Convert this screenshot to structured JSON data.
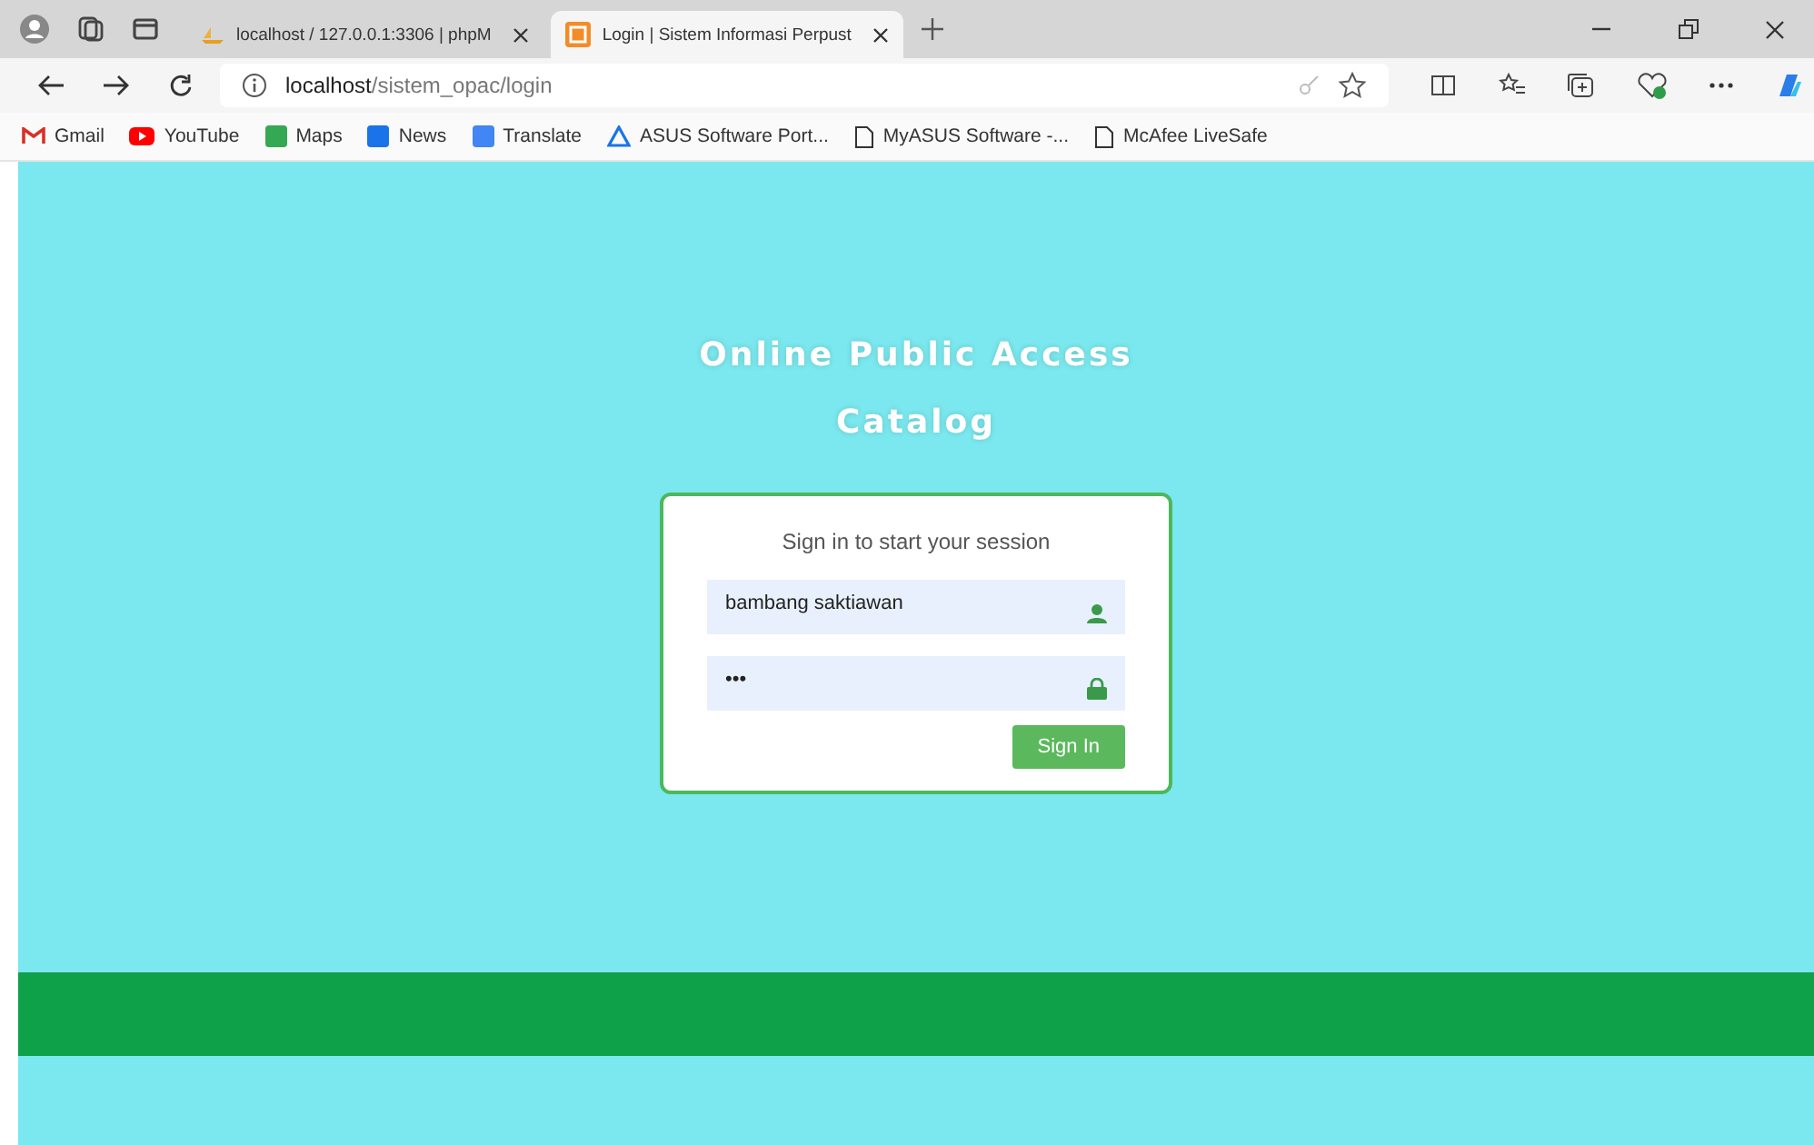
{
  "browser": {
    "tabs": [
      {
        "title": "localhost / 127.0.0.1:3306 | phpM",
        "kind": "db",
        "selected": false
      },
      {
        "title": "Login | Sistem Informasi Perpust",
        "kind": "app",
        "selected": true
      }
    ],
    "url_host": "localhost",
    "url_path": "/sistem_opac/login",
    "bookmarks": [
      {
        "label": "Gmail",
        "kind": "gmail"
      },
      {
        "label": "YouTube",
        "kind": "youtube"
      },
      {
        "label": "Maps",
        "kind": "maps"
      },
      {
        "label": "News",
        "kind": "news"
      },
      {
        "label": "Translate",
        "kind": "translate"
      },
      {
        "label": "ASUS Software Port...",
        "kind": "asus"
      },
      {
        "label": "MyASUS Software -...",
        "kind": "page"
      },
      {
        "label": "McAfee LiveSafe",
        "kind": "page"
      }
    ]
  },
  "page": {
    "title_line1": "Online Public Access",
    "title_line2": "Catalog",
    "login": {
      "message": "Sign in to start your session",
      "username": "bambang saktiawan",
      "password": "•••",
      "button": "Sign In"
    }
  }
}
